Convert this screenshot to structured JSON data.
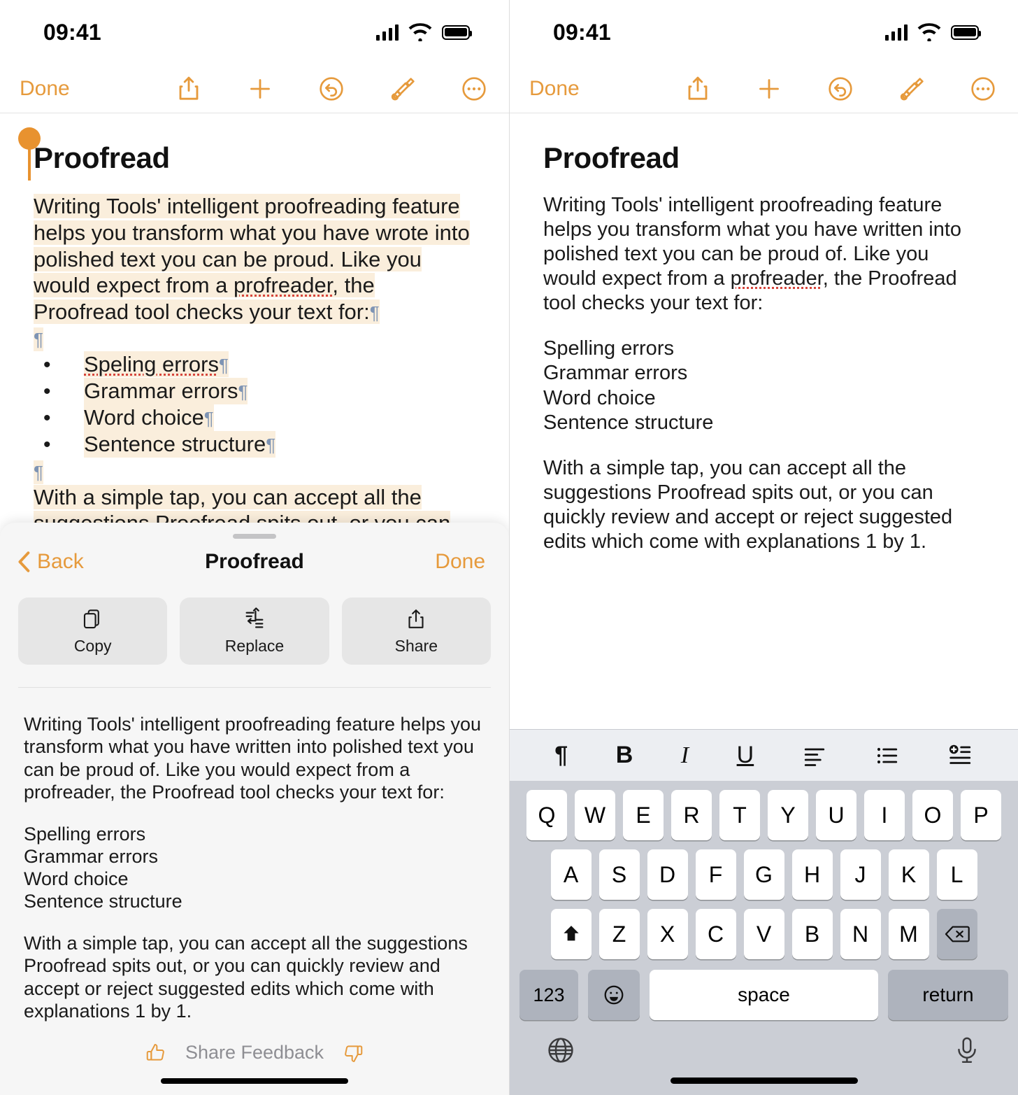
{
  "status": {
    "time": "09:41",
    "signal_icon": "cellular-bars-icon",
    "wifi_icon": "wifi-icon",
    "battery_icon": "battery-icon"
  },
  "toolbar": {
    "done_label": "Done",
    "icons": [
      {
        "name": "share-icon",
        "label": "Share"
      },
      {
        "name": "plus-icon",
        "label": "New"
      },
      {
        "name": "undo-icon",
        "label": "Undo"
      },
      {
        "name": "markup-brush-icon",
        "label": "Markup"
      },
      {
        "name": "more-circle-icon",
        "label": "More"
      }
    ]
  },
  "document": {
    "title": "Proofread",
    "original": {
      "paragraph_1": "Writing Tools' intelligent proofreading feature helps you transform what you have wrote into polished text you can be proud. Like you would expect from a ",
      "misspelled_word": "profreader",
      "paragraph_1_end": ", the Proofread tool checks your text for:",
      "bullets": [
        "Speling errors",
        "Grammar errors",
        "Word choice",
        "Sentence structure"
      ],
      "bullet_misspelled": "Speling",
      "paragraph_2": "With a simple tap, you can accept all the suggestions Proofread spits out, or you can",
      "pilcrow_glyph": "¶",
      "bullet_glyph": "•"
    },
    "revised": {
      "paragraph_1_start": "Writing Tools' intelligent proofreading feature helps you transform what you have written into polished text you can be proud of. Like you would expect from a ",
      "misspelled_word": "profreader",
      "paragraph_1_end": ", the Proofread tool checks your text for:",
      "list": [
        "Spelling errors",
        "Grammar errors",
        "Word choice",
        "Sentence structure"
      ],
      "paragraph_2": "With a simple tap, you can accept all the suggestions Proofread spits out, or you can quickly review and accept or reject suggested edits which come with explanations 1 by 1."
    }
  },
  "sheet": {
    "back_label": "Back",
    "title": "Proofread",
    "done_label": "Done",
    "grabber_icon": "sheet-grabber-icon",
    "chevron_icon": "chevron-left-icon",
    "actions": [
      {
        "label": "Copy",
        "icon": "copy-icon"
      },
      {
        "label": "Replace",
        "icon": "replace-icon"
      },
      {
        "label": "Share",
        "icon": "share-icon"
      }
    ],
    "body": {
      "paragraph_1": "Writing Tools' intelligent proofreading feature helps you transform what you have written into polished text you can be proud of. Like you would expect from a profreader, the Proofread tool checks your text for:",
      "list": [
        "Spelling errors",
        "Grammar errors",
        "Word choice",
        "Sentence structure"
      ],
      "paragraph_2": "With a simple tap, you can accept all the suggestions Proofread spits out, or you can quickly review and accept or reject suggested edits which come with explanations 1 by 1."
    },
    "feedback": {
      "label": "Share Feedback",
      "thumbs_up_icon": "thumbs-up-icon",
      "thumbs_down_icon": "thumbs-down-icon"
    }
  },
  "keyboard": {
    "format_bar": [
      {
        "name": "pilcrow-icon",
        "glyph": "¶"
      },
      {
        "name": "bold-icon",
        "glyph": "B"
      },
      {
        "name": "italic-icon",
        "glyph": "I"
      },
      {
        "name": "underline-icon",
        "glyph": "U"
      },
      {
        "name": "align-left-icon",
        "glyph": ""
      },
      {
        "name": "bullet-list-icon",
        "glyph": ""
      },
      {
        "name": "insert-row-icon",
        "glyph": ""
      }
    ],
    "row1": [
      "Q",
      "W",
      "E",
      "R",
      "T",
      "Y",
      "U",
      "I",
      "O",
      "P"
    ],
    "row2": [
      "A",
      "S",
      "D",
      "F",
      "G",
      "H",
      "J",
      "K",
      "L"
    ],
    "row3": [
      "Z",
      "X",
      "C",
      "V",
      "B",
      "N",
      "M"
    ],
    "shift_icon": "shift-icon",
    "backspace_icon": "backspace-icon",
    "numbers_label": "123",
    "emoji_icon": "emoji-icon",
    "space_label": "space",
    "return_label": "return",
    "globe_icon": "globe-icon",
    "microphone_icon": "microphone-icon"
  },
  "colors": {
    "accent": "#E69A3C",
    "selection_highlight": "#faeedc",
    "handle": "#E8922F",
    "spellcheck": "#d6453c",
    "keyboard_bg": "#cbced5"
  }
}
